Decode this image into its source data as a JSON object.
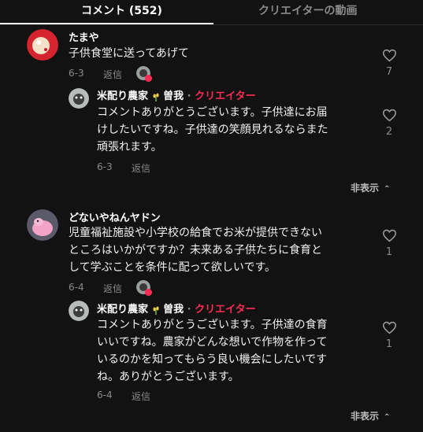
{
  "tabs": {
    "comments": "コメント (552)",
    "creator_videos": "クリエイターの動画"
  },
  "threads": [
    {
      "username": "たまや",
      "text_lines": [
        "子供食堂に送ってあげて"
      ],
      "date": "6-3",
      "reply_label": "返信",
      "likes": "7",
      "reply": {
        "username": "米配り農家",
        "username_suffix": "曽我",
        "separator": "·",
        "creator_label": "クリエイター",
        "text_lines": [
          "コメントありがとうございます。子供達にお届",
          "けしたいですね。子供達の笑顔見れるならまた",
          "頑張れます。"
        ],
        "date": "6-3",
        "reply_label": "返信",
        "likes": "2"
      },
      "hide_label": "非表示"
    },
    {
      "username": "どないやねんヤドン",
      "text_lines": [
        "児童福祉施設や小学校の給食でお米が提供できない",
        "ところはいかがですか？未来ある子供たちに食育と",
        "して学ぶことを条件に配って欲しいです。"
      ],
      "date": "6-4",
      "reply_label": "返信",
      "likes": "1",
      "reply": {
        "username": "米配り農家",
        "username_suffix": "曽我",
        "separator": "·",
        "creator_label": "クリエイター",
        "text_lines": [
          "コメントありがとうございます。子供達の食育",
          "いいですね。農家がどんな想いで作物を作って",
          "いるのかを知ってもらう良い機会にしたいです",
          "ね。ありがとうございます。"
        ],
        "date": "6-4",
        "reply_label": "返信",
        "likes": "1"
      },
      "hide_label": "非表示"
    }
  ],
  "colors": {
    "background": "#121212",
    "accent": "#fe2c55",
    "muted": "#8a8a8a"
  }
}
